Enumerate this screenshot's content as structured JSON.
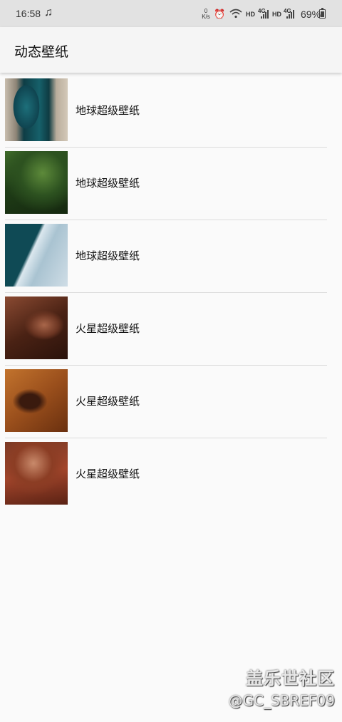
{
  "status_bar": {
    "time": "16:58",
    "speed_value": "0",
    "speed_unit": "K/s",
    "hd1": "HD",
    "net1": "4G",
    "hd2": "HD",
    "net2": "4G",
    "battery": "69%"
  },
  "app_bar": {
    "title": "动态壁纸"
  },
  "items": [
    {
      "label": "地球超级壁纸"
    },
    {
      "label": "地球超级壁纸"
    },
    {
      "label": "地球超级壁纸"
    },
    {
      "label": "火星超级壁纸"
    },
    {
      "label": "火星超级壁纸"
    },
    {
      "label": "火星超级壁纸"
    }
  ],
  "watermark": {
    "line1": "盖乐世社区",
    "line2": "@GC_SBREF09"
  }
}
